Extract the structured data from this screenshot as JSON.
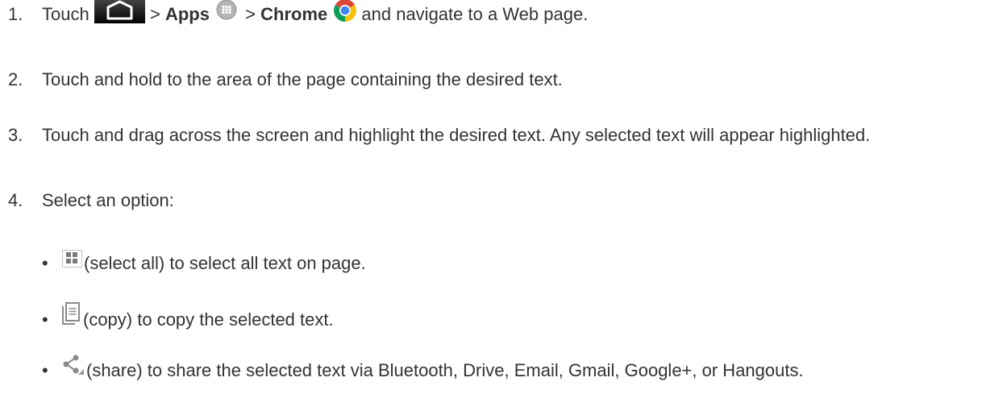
{
  "steps": [
    {
      "number": "1.",
      "parts": [
        "Touch",
        "> ",
        "Apps",
        " > ",
        "Chrome",
        "and navigate to a Web page."
      ]
    },
    {
      "number": "2.",
      "text": "Touch and hold to the area of the page containing the desired text."
    },
    {
      "number": "3.",
      "text": "Touch and drag across the screen and highlight the desired text. Any selected text will appear highlighted."
    },
    {
      "number": "4.",
      "text": "Select an option:"
    }
  ],
  "options": [
    {
      "bullet": "•",
      "icon": "select-all-icon",
      "text": "(select all) to select all text on page."
    },
    {
      "bullet": "•",
      "icon": "copy-icon",
      "text": "(copy) to copy the selected text."
    },
    {
      "bullet": "•",
      "icon": "share-icon",
      "text": "(share) to share the selected text via Bluetooth, Drive, Email, Gmail, Google+, or Hangouts."
    }
  ]
}
